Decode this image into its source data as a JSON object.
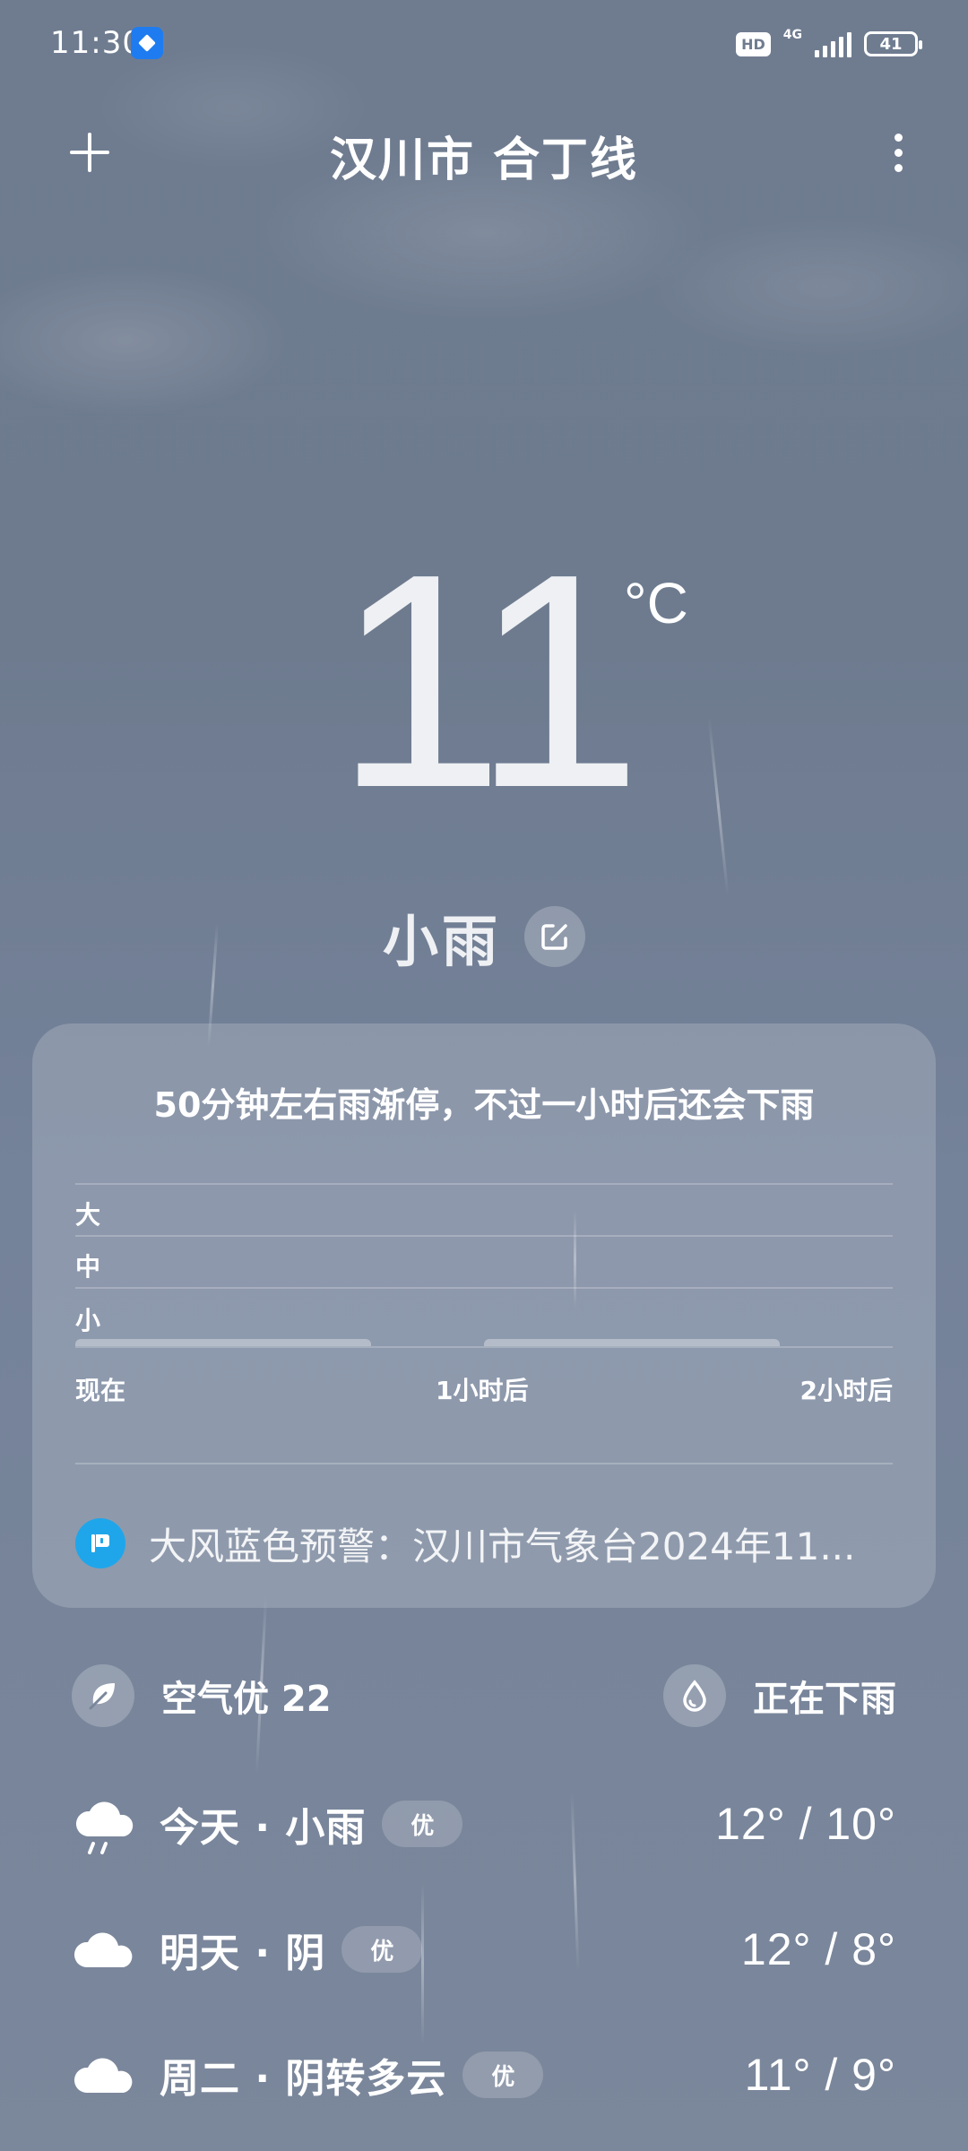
{
  "status_bar": {
    "time": "11:30",
    "hd": "HD",
    "network": "4G",
    "battery": "41",
    "signal_bars": 5
  },
  "header": {
    "location": "汉川市 合丁线"
  },
  "current": {
    "temperature": "11",
    "unit": "°C",
    "condition": "小雨"
  },
  "precipitation": {
    "summary": "50分钟左右雨渐停，不过一小时后还会下雨",
    "levels": [
      "大",
      "中",
      "小"
    ],
    "time_labels": [
      "现在",
      "1小时后",
      "2小时后"
    ],
    "alert": "大风蓝色预警：汉川市气象台2024年11...",
    "alert_color": "#1fa6ea"
  },
  "info": {
    "air_quality": "空气优 22",
    "rain_status": "正在下雨"
  },
  "forecast": [
    {
      "label": "今天 · 小雨",
      "aqi": "优",
      "temp": "12° / 10°",
      "icon": "rain-cloud-icon"
    },
    {
      "label": "明天 · 阴",
      "aqi": "优",
      "temp": "12° / 8°",
      "icon": "cloud-icon"
    },
    {
      "label": "周二 · 阴转多云",
      "aqi": "优",
      "temp": "11° / 9°",
      "icon": "cloud-icon"
    }
  ]
}
